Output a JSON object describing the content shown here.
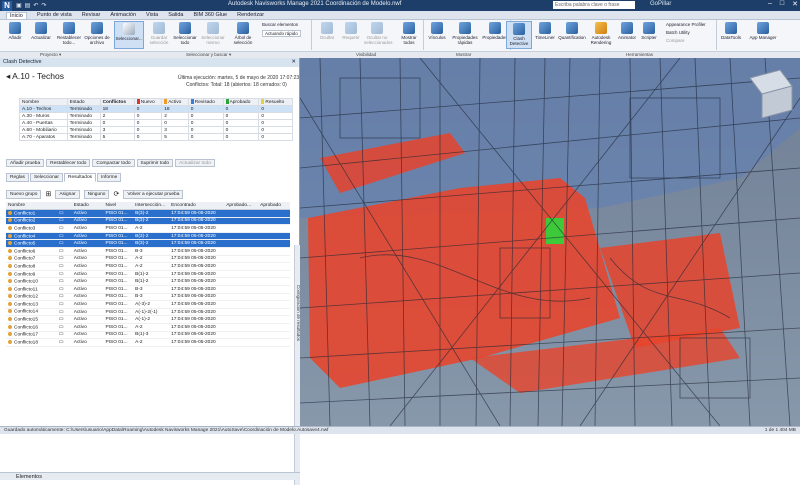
{
  "app": {
    "logo": "N",
    "title": "Autodesk Navisworks Manage 2021  Coordinación de Modelo.nwf",
    "search_placeholder": "Escriba palabra clave o frase",
    "user": "GoPillar"
  },
  "tabs": [
    "Inicio",
    "Punto de vista",
    "Revisar",
    "Animación",
    "Vista",
    "Salida",
    "BIM 360 Glue",
    "Renderizar"
  ],
  "ribbon": {
    "buttons": [
      "Añadir",
      "Actualizar",
      "Restablecer todo...",
      "Opciones de archivo",
      "Seleccionar...",
      "Guardar selección",
      "Seleccionar todo",
      "Seleccionar mismo",
      "Árbol de selección",
      "Ocultar",
      "Requerir",
      "Ocultar no seleccionados",
      "Mostrar todos",
      "Vínculos",
      "Propiedades rápidas",
      "Propiedades",
      "Clash Detective",
      "TimeLiner",
      "Quantification",
      "Autodesk Rendering",
      "Animator",
      "Scripter",
      "DataTools",
      "App Manager"
    ],
    "small": [
      "Buscar elementos",
      "Appearance Profiler",
      "Batch Utility",
      "Compare"
    ],
    "dropdown": "Actuando rápido",
    "groups": [
      "Proyecto ▾",
      "Seleccionar y buscar ▾",
      "Visibilidad",
      "Mostrar",
      "Herramientas"
    ]
  },
  "panel": {
    "title": "Clash Detective",
    "test_name": "A.10 - Techos",
    "last_run": "Última ejecución: martes, 5 de mayo de 2020 17:07:23",
    "conflicts_summary": "Conflictos: Total: 18 (abiertos: 18  cerrados: 0)",
    "tests_headers": [
      "Nombre",
      "Estado",
      "Conflictos",
      "Nuevo",
      "Activo",
      "Revisado",
      "Aprobado",
      "Resuelto"
    ],
    "tests": [
      [
        "A.10 - Techos",
        "Terminado",
        "18",
        "0",
        "18",
        "0",
        "0",
        "0"
      ],
      [
        "A.30 - Muros",
        "Terminado",
        "2",
        "0",
        "2",
        "0",
        "0",
        "0"
      ],
      [
        "A.40 - Puertas",
        "Terminado",
        "0",
        "0",
        "0",
        "0",
        "0",
        "0"
      ],
      [
        "A.60 - Mobiliario",
        "Terminado",
        "3",
        "0",
        "3",
        "0",
        "0",
        "0"
      ],
      [
        "A.70 - Aparatos",
        "Terminado",
        "5",
        "0",
        "5",
        "0",
        "0",
        "0"
      ]
    ],
    "test_buttons": [
      "Añadir prueba",
      "Restablecer todo",
      "Compactar todo",
      "Suprimir todo",
      "Actualizar todo"
    ],
    "subtabs": [
      "Reglas",
      "Seleccionar",
      "Resultados",
      "Informe"
    ],
    "result_tools": [
      "Nuevo grupo",
      "Asignar",
      "Ninguno",
      "Volver a ejecutar prueba"
    ],
    "results_headers": [
      "Nombre",
      "",
      "Estado",
      "Nivel",
      "Intersección...",
      "Encontrado",
      "Aprobado...",
      "Aprobado"
    ],
    "results": [
      [
        "Conflicto1",
        "Activo",
        "PISO 01...",
        "B(3)-2",
        "17:04:59 05-05-2020"
      ],
      [
        "Conflicto2",
        "Activo",
        "PISO 01...",
        "B(3)-2",
        "17:04:59 05-05-2020"
      ],
      [
        "Conflicto3",
        "Activo",
        "PISO 01...",
        "A-2",
        "17:04:59 05-05-2020"
      ],
      [
        "Conflicto4",
        "Activo",
        "PISO 01...",
        "B(3)-2",
        "17:04:59 05-05-2020"
      ],
      [
        "Conflicto5",
        "Activo",
        "PISO 01...",
        "B(3)-2",
        "17:04:59 05-05-2020"
      ],
      [
        "Conflicto6",
        "Activo",
        "PISO 01...",
        "B-3",
        "17:04:59 05-05-2020"
      ],
      [
        "Conflicto7",
        "Activo",
        "PISO 01...",
        "A-2",
        "17:04:59 05-05-2020"
      ],
      [
        "Conflicto8",
        "Activo",
        "PISO 01...",
        "A-2",
        "17:04:59 05-05-2020"
      ],
      [
        "Conflicto9",
        "Activo",
        "PISO 01...",
        "B(1)-2",
        "17:04:59 05-05-2020"
      ],
      [
        "Conflicto10",
        "Activo",
        "PISO 01...",
        "B(1)-2",
        "17:04:59 05-05-2020"
      ],
      [
        "Conflicto11",
        "Activo",
        "PISO 01...",
        "B-3",
        "17:04:59 05-05-2020"
      ],
      [
        "Conflicto12",
        "Activo",
        "PISO 01...",
        "B-3",
        "17:04:59 05-05-2020"
      ],
      [
        "Conflicto13",
        "Activo",
        "PISO 01...",
        "A(-3)-2",
        "17:04:59 05-05-2020"
      ],
      [
        "Conflicto14",
        "Activo",
        "PISO 01...",
        "A(-1)-2(-1)",
        "17:04:59 05-05-2020"
      ],
      [
        "Conflicto15",
        "Activo",
        "PISO 01...",
        "A(-1)-2",
        "17:04:59 05-05-2020"
      ],
      [
        "Conflicto16",
        "Activo",
        "PISO 01...",
        "A-2",
        "17:04:59 05-05-2020"
      ],
      [
        "Conflicto17",
        "Activo",
        "PISO 01...",
        "B(1)-3",
        "17:04:59 05-05-2020"
      ],
      [
        "Conflicto18",
        "Activo",
        "PISO 01...",
        "A-2",
        "17:04:59 05-05-2020"
      ]
    ],
    "sidebar_label": "Configuración de resultados",
    "elements_label": "Elementos"
  },
  "status": {
    "text": "Guardado automáticamente: C:\\Users\\usuario\\AppData\\Roaming\\Autodesk Navisworks Manage 2021\\AutoSave\\Coordinación de Modelo.Autosave4.nwf",
    "right": "1 de 1   404 MB"
  },
  "colors": {
    "title_bar": "#1d3e68",
    "selected_row": "#2a6fcb",
    "clash_red": "#e8432b",
    "clash_green": "#3ec93a"
  }
}
